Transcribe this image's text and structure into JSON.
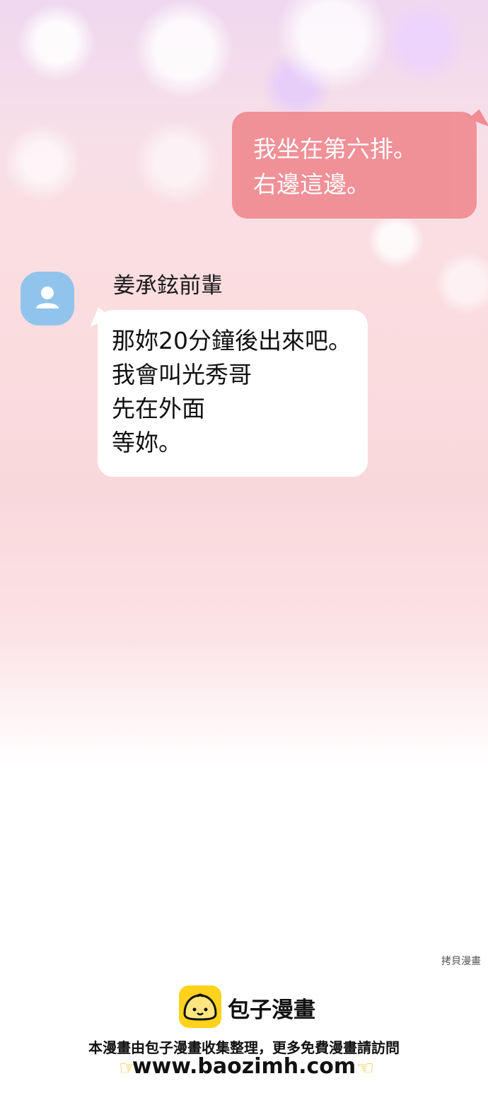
{
  "chat": {
    "outgoing": {
      "text": "我坐在第六排。\n右邊這邊。",
      "bubble_color": "#f08c93"
    },
    "incoming": {
      "sender_name": "姜承鉉前輩",
      "avatar_icon": "user-icon",
      "avatar_color": "#91c4ec",
      "text": "那妳20分鐘後出來吧。\n我會叫光秀哥\n先在外面\n等妳。"
    }
  },
  "watermark": {
    "corner_text": "拷貝漫畫",
    "brand_name": "包子漫畫",
    "logo_icon": "baozi-logo-icon",
    "logo_color": "#ffd21c",
    "notice": "本漫畫由包子漫畫收集整理，更多免費漫畫請訪問",
    "url": "www.baozimh.com",
    "pointer_icons": [
      "hand-pointing-right-icon",
      "hand-pointing-left-icon"
    ]
  }
}
